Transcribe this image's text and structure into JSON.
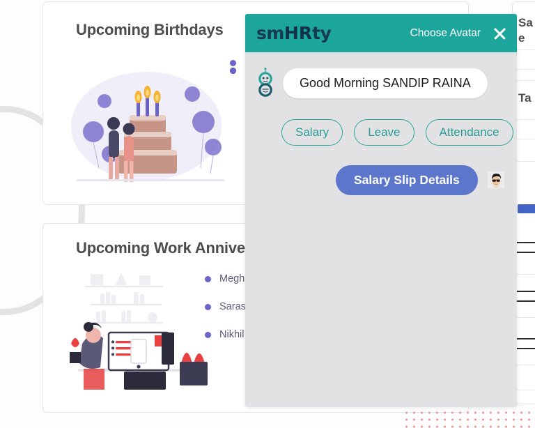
{
  "dashboard": {
    "birthdays": {
      "title": "Upcoming Birthdays",
      "illustration_name": "birthday-cake-illustration",
      "items": [
        "",
        "",
        "",
        "",
        "",
        ""
      ]
    },
    "anniversaries": {
      "title": "Upcoming Work Anniversaries",
      "illustration_name": "work-desk-illustration",
      "items": [
        "Megh",
        "Saras\n(DOJ)",
        "Nikhil"
      ]
    },
    "right_card": {
      "title_line1": "Sa",
      "title_line2": "e",
      "title_line3": "Ta"
    }
  },
  "chat": {
    "logo": {
      "prefix": "sm",
      "highlight": "HR",
      "suffix": "ty"
    },
    "header": {
      "choose_avatar_label": "Choose Avatar",
      "close_icon": "close-icon"
    },
    "greeting": "Good Morning SANDIP RAINA",
    "bot_icon": "robot-avatar-icon",
    "quick_actions": [
      {
        "label": "Salary"
      },
      {
        "label": "Leave"
      },
      {
        "label": "Attendance"
      }
    ],
    "primary_action": {
      "label": "Salary Slip Details"
    },
    "user_avatar_icon": "user-avatar-sunglasses-icon"
  },
  "colors": {
    "teal": "#1ca69c",
    "panel_gray": "#e2e2e4",
    "blue_button": "#5c76cb",
    "bullet_purple": "#6c63c8",
    "dot_pattern": "#ef9a9a"
  }
}
